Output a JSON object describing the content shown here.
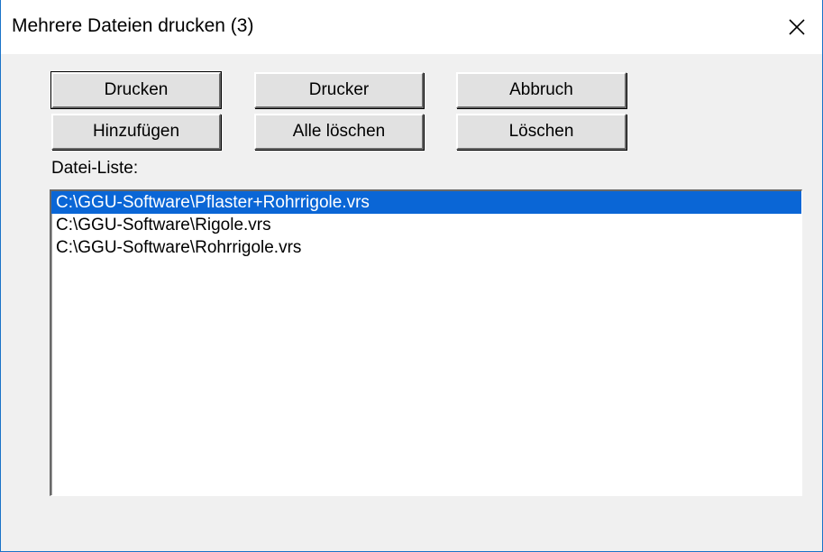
{
  "window": {
    "title": "Mehrere Dateien drucken (3)",
    "close_icon": "close-icon"
  },
  "buttons": {
    "print": "Drucken",
    "printer": "Drucker",
    "cancel": "Abbruch",
    "add": "Hinzufügen",
    "delete_all": "Alle löschen",
    "delete": "Löschen"
  },
  "file_list": {
    "label": "Datei-Liste:",
    "items": [
      "C:\\GGU-Software\\Pflaster+Rohrrigole.vrs",
      "C:\\GGU-Software\\Rigole.vrs",
      "C:\\GGU-Software\\Rohrrigole.vrs"
    ],
    "selected_index": 0
  },
  "colors": {
    "selection": "#0a66d6",
    "window_border": "#1a73c8",
    "dialog_bg": "#f0f0f0"
  }
}
